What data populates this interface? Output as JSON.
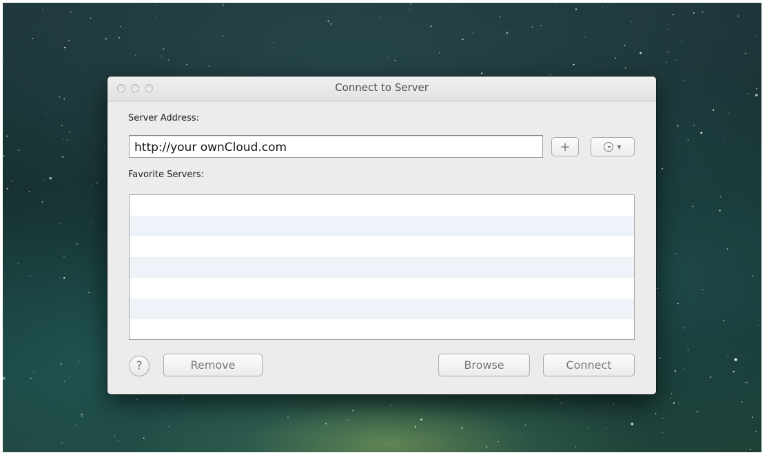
{
  "window": {
    "title": "Connect to Server"
  },
  "server_address": {
    "label": "Server Address:",
    "value": "http://your ownCloud.com"
  },
  "favorites": {
    "label": "Favorite Servers:",
    "items": []
  },
  "buttons": {
    "add_label": "+",
    "help_label": "?",
    "remove_label": "Remove",
    "browse_label": "Browse",
    "connect_label": "Connect"
  },
  "icons": {
    "recent": "clock-icon",
    "dropdown": "chevron-down-icon",
    "add": "plus-icon",
    "help": "help-icon"
  },
  "colors": {
    "list_alt_row": "#eef2f9",
    "window_bg": "#ececec"
  }
}
